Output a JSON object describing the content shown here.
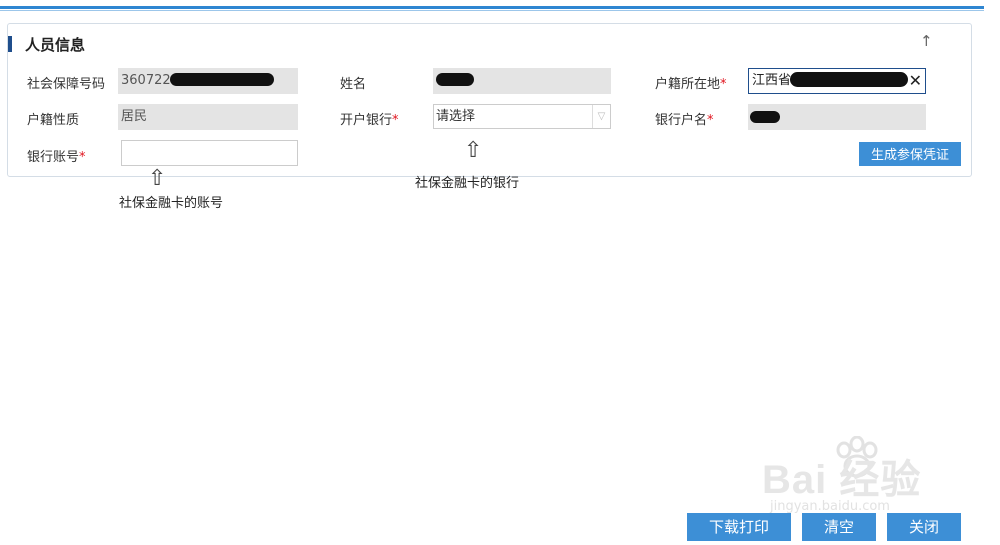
{
  "panel": {
    "title": "人员信息",
    "collapse_icon": "arrow-up-icon"
  },
  "fields": {
    "social_security_no": {
      "label": "社会保障号码",
      "value": "360722"
    },
    "name": {
      "label": "姓名",
      "value": ""
    },
    "household_location": {
      "label": "户籍所在地",
      "required_mark": "*",
      "value": "江西省"
    },
    "household_type": {
      "label": "户籍性质",
      "value": "居民"
    },
    "bank": {
      "label": "开户银行",
      "required_mark": "*",
      "selected": "请选择"
    },
    "bank_account_name": {
      "label": "银行户名",
      "required_mark": "*",
      "value": ""
    },
    "bank_account_no": {
      "label": "银行账号",
      "required_mark": "*",
      "value": ""
    }
  },
  "buttons": {
    "generate": "生成参保凭证",
    "download_print": "下载打印",
    "clear": "清空",
    "close": "关闭"
  },
  "annotations": {
    "bank_note": "社保金融卡的银行",
    "account_note": "社保金融卡的账号",
    "arrow": "⇧"
  },
  "watermark": {
    "brand": "Bai  经验",
    "url": "jingyan.baidu.com"
  },
  "colors": {
    "accent": "#3d8fd6",
    "header_line": "#2f86d1",
    "title_bar": "#1f4e8c",
    "required": "#e0141e"
  }
}
